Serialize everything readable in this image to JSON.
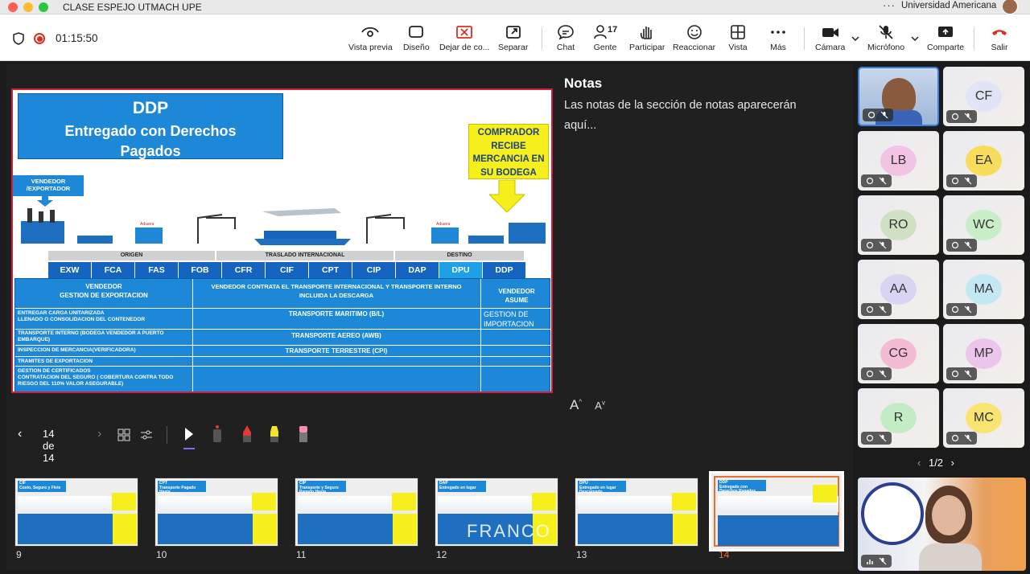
{
  "window": {
    "title": "CLASE ESPEJO UTMACH UPE",
    "org": "Universidad Americana"
  },
  "toolbar": {
    "timer": "01:15:50",
    "people_count": "17",
    "buttons": {
      "preview": "Vista previa",
      "design": "Diseño",
      "stop_sharing": "Dejar de co...",
      "separate": "Separar",
      "chat": "Chat",
      "people": "Gente",
      "raise": "Participar",
      "react": "Reaccionar",
      "view": "Vista",
      "more": "Más",
      "camera": "Cámara",
      "mic": "Micrófono",
      "share": "Comparte",
      "leave": "Salir"
    },
    "colors": {
      "leave": "#d93025",
      "record": "#d93025"
    }
  },
  "slide": {
    "title": "DDP",
    "subtitle_1": "Entregado con Derechos",
    "subtitle_2": "Pagados",
    "comprador": [
      "COMPRADOR",
      "RECIBE",
      "MERCANCIA EN",
      "SU BODEGA"
    ],
    "vendedor_label_1": "VENDEDOR",
    "vendedor_label_2": "/EXPORTADOR",
    "aduana_1": "Aduana",
    "aduana_2": "Aduana",
    "sections": {
      "origen": "ORIGEN",
      "traslado": "TRASLADO INTERNACIONAL",
      "destino": "DESTINO"
    },
    "incoterms": [
      "EXW",
      "FCA",
      "FAS",
      "FOB",
      "CFR",
      "CIF",
      "CPT",
      "CIP",
      "DAP",
      "DPU",
      "DDP"
    ],
    "table": {
      "col1_head_1": "VENDEDOR",
      "col1_head_2": "GESTION DE EXPORTACION",
      "col2_head_1": "VENDEDOR CONTRATA EL TRANSPORTE INTERNACIONAL Y TRANSPORTE INTERNO",
      "col2_head_2": "INCLUIDA LA DESCARGA",
      "col3_head_1": "VENDEDOR",
      "col3_head_2": "ASUME",
      "rows": [
        {
          "left": "ENTREGAR CARGA UNITARIZADA",
          "left2": "LLENADO O CONSOLIDACION DEL CONTENEDOR",
          "mid": "TRANSPORTE MARITIMO (B/L)",
          "right": "GESTION DE",
          "right2": "IMPORTACION"
        },
        {
          "left": "TRANSPORTE INTERNO (BODEGA VENDEDOR A PUERTO",
          "left2": "EMBARQUE)",
          "mid": "TRANSPORTE AEREO (AWB)",
          "right": "",
          "right2": ""
        },
        {
          "left": "INSPECCION DE MERCANCIA(VERIFICADORA)",
          "left2": "",
          "mid": "TRANSPORTE TERRESTRE (CPI)",
          "right": "",
          "right2": ""
        },
        {
          "left": "TRAMITES DE EXPORTACION",
          "left2": "",
          "mid": "",
          "right": "",
          "right2": ""
        },
        {
          "left": "GESTION DE CERTIFICADOS",
          "left2": "CONTRATACION DEL SEGURO ( COBERTURA CONTRA TODO",
          "left3": "RIESGO DEL 110% VALOR ASEGURABLE)",
          "mid": "",
          "right": "",
          "right2": ""
        }
      ]
    }
  },
  "notes": {
    "heading": "Notas",
    "body": "Las notas de la sección de notas aparecerán aquí..."
  },
  "slide_nav": {
    "counter": "14 de 14"
  },
  "thumbnails": [
    {
      "num": "9",
      "t1": "CIF",
      "t2": "Costo, Seguro y Flete"
    },
    {
      "num": "10",
      "t1": "CPT",
      "t2": "Transporte Pagado Hasta"
    },
    {
      "num": "11",
      "t1": "CIP",
      "t2": "Transporte y Seguro Pagado Hasta"
    },
    {
      "num": "12",
      "t1": "DAP",
      "t2": "Entregado en lugar"
    },
    {
      "num": "13",
      "t1": "DPU",
      "t2": "Entregado en lugar Descargado"
    },
    {
      "num": "14",
      "t1": "DDP",
      "t2": "Entregado con Derechos Pagados"
    }
  ],
  "overlay_name": "FRANCO",
  "participants": [
    {
      "initials": "",
      "video": true,
      "color": "#4a72b8"
    },
    {
      "initials": "CF",
      "color": "#e0e4f6"
    },
    {
      "initials": "LB",
      "color": "#f2c4e4"
    },
    {
      "initials": "EA",
      "color": "#f8dc5c"
    },
    {
      "initials": "RO",
      "color": "#cfe0c4"
    },
    {
      "initials": "WC",
      "color": "#c8eec8"
    },
    {
      "initials": "AA",
      "color": "#d8d4f2"
    },
    {
      "initials": "MA",
      "color": "#c4e8f2"
    },
    {
      "initials": "CG",
      "color": "#f4bcd4"
    },
    {
      "initials": "MP",
      "color": "#ecc6ea"
    },
    {
      "initials": "R",
      "color": "#c4ecc4"
    },
    {
      "initials": "MC",
      "color": "#f8e470"
    }
  ],
  "gallery_pager": "1/2",
  "font_controls": {
    "increase": "A",
    "decrease": "A"
  }
}
